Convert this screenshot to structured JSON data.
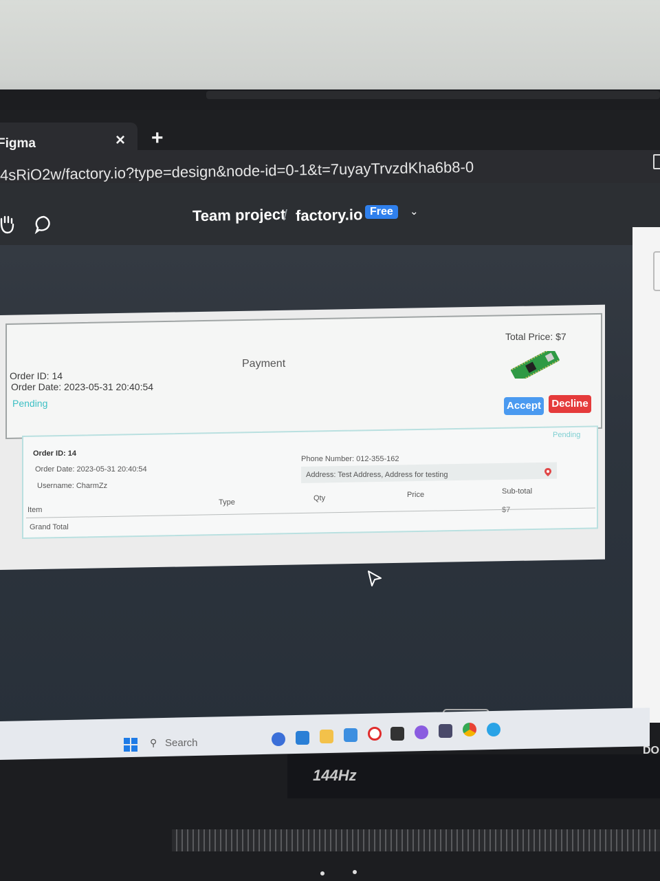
{
  "browser": {
    "tab_title": "Figma",
    "tab_close": "×",
    "new_tab": "+",
    "url": "4sRiO2w/factory.io?type=design&node-id=0-1&t=7uyayTrvzdKha6b8-0"
  },
  "figma": {
    "breadcrumb_team": "Team project",
    "breadcrumb_sep": "/",
    "file_name": "factory.io",
    "plan_badge": "Free",
    "dropdown": "⌄"
  },
  "order_card": {
    "order_id": "Order ID: 14",
    "order_date": "Order Date: 2023-05-31 20:40:54",
    "status": "Pending",
    "payment_label": "Payment",
    "total_price": "Total Price: $7",
    "accept_label": "Accept",
    "decline_label": "Decline"
  },
  "order_detail": {
    "status": "Pending",
    "order_id": "Order ID: 14",
    "order_date": "Order Date: 2023-05-31 20:40:54",
    "username": "Username: CharmZz",
    "phone": "Phone Number: 012-355-162",
    "address": "Address: Test Address, Address for testing",
    "columns": [
      "Item",
      "Type",
      "Qty",
      "Price",
      "Sub-total"
    ],
    "subtotal_value": "$7",
    "grand_total_label": "Grand Total"
  },
  "taskbar": {
    "search_placeholder": "Search"
  },
  "device": {
    "refresh_rate": "144Hz",
    "brand": "DOL"
  },
  "colors": {
    "accent_blue": "#4a9af0",
    "decline_red": "#e53b3b",
    "pending_teal": "#3cbfc4",
    "canvas_bg": "#2f363f"
  }
}
